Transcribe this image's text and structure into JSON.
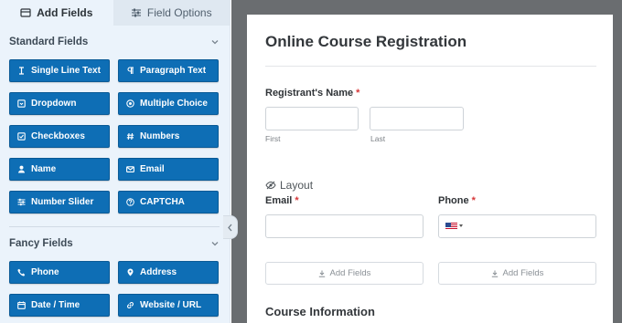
{
  "tabs": {
    "add_fields": "Add Fields",
    "field_options": "Field Options"
  },
  "standard": {
    "title": "Standard Fields",
    "buttons": [
      {
        "label": "Single Line Text",
        "icon": "text-cursor-icon"
      },
      {
        "label": "Paragraph Text",
        "icon": "paragraph-icon"
      },
      {
        "label": "Dropdown",
        "icon": "dropdown-icon"
      },
      {
        "label": "Multiple Choice",
        "icon": "radio-icon"
      },
      {
        "label": "Checkboxes",
        "icon": "checkbox-icon"
      },
      {
        "label": "Numbers",
        "icon": "hash-icon"
      },
      {
        "label": "Name",
        "icon": "user-icon"
      },
      {
        "label": "Email",
        "icon": "envelope-icon"
      },
      {
        "label": "Number Slider",
        "icon": "sliders-icon"
      },
      {
        "label": "CAPTCHA",
        "icon": "question-icon"
      }
    ]
  },
  "fancy": {
    "title": "Fancy Fields",
    "buttons": [
      {
        "label": "Phone",
        "icon": "phone-icon"
      },
      {
        "label": "Address",
        "icon": "map-pin-icon"
      },
      {
        "label": "Date / Time",
        "icon": "calendar-icon"
      },
      {
        "label": "Website / URL",
        "icon": "link-icon"
      }
    ]
  },
  "form": {
    "title": "Online Course Registration",
    "name_label": "Registrant's Name",
    "required_mark": "*",
    "first_sublabel": "First",
    "last_sublabel": "Last",
    "layout_label": "Layout",
    "email_label": "Email",
    "phone_label": "Phone",
    "add_fields_label": "Add Fields",
    "course_section": "Course Information"
  },
  "colors": {
    "button_bg": "#0e6eb5",
    "panel_bg": "#ebf3fb",
    "preview_bg": "#6a6d70",
    "required": "#d63638"
  }
}
